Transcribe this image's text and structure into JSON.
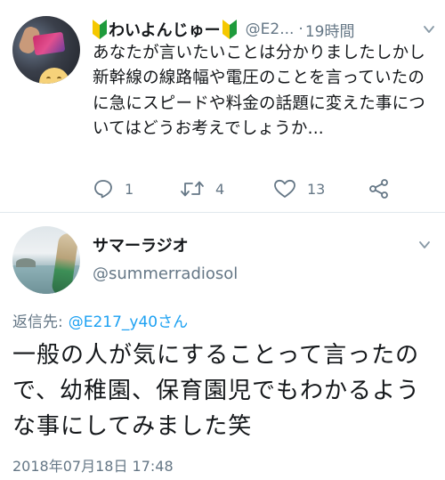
{
  "tweet1": {
    "display_name": "わいよんじゅー",
    "handle": "@E2...",
    "separator": "·",
    "time": "19時間",
    "text": "あなたが言いたいことは分かりましたしかし新幹線の線路幅や電圧のことを言っていたのに急にスピードや料金の話題に変えた事についてはどうお考えでしょうか...",
    "actions": {
      "reply_count": "1",
      "retweet_count": "4",
      "like_count": "13"
    },
    "icons": {
      "beginner": "beginner-mark-icon",
      "more": "chevron-down-icon",
      "reply": "reply-icon",
      "retweet": "retweet-icon",
      "like": "heart-icon",
      "share": "share-icon"
    }
  },
  "tweet2": {
    "display_name": "サマーラジオ",
    "handle": "@summerradiosol",
    "reply_to_label": "返信先:",
    "reply_to_mention": "@E217_y40さん",
    "text": "一般の人が気にすることって言ったので、幼稚園、保育園児でもわかるような事にしてみました笑",
    "timestamp": "2018年07月18日 17:48"
  },
  "colors": {
    "text_primary": "#14171a",
    "text_secondary": "#657786",
    "link": "#1da1f2",
    "beginner_green": "#1e9b3c",
    "beginner_yellow": "#f5c800"
  }
}
